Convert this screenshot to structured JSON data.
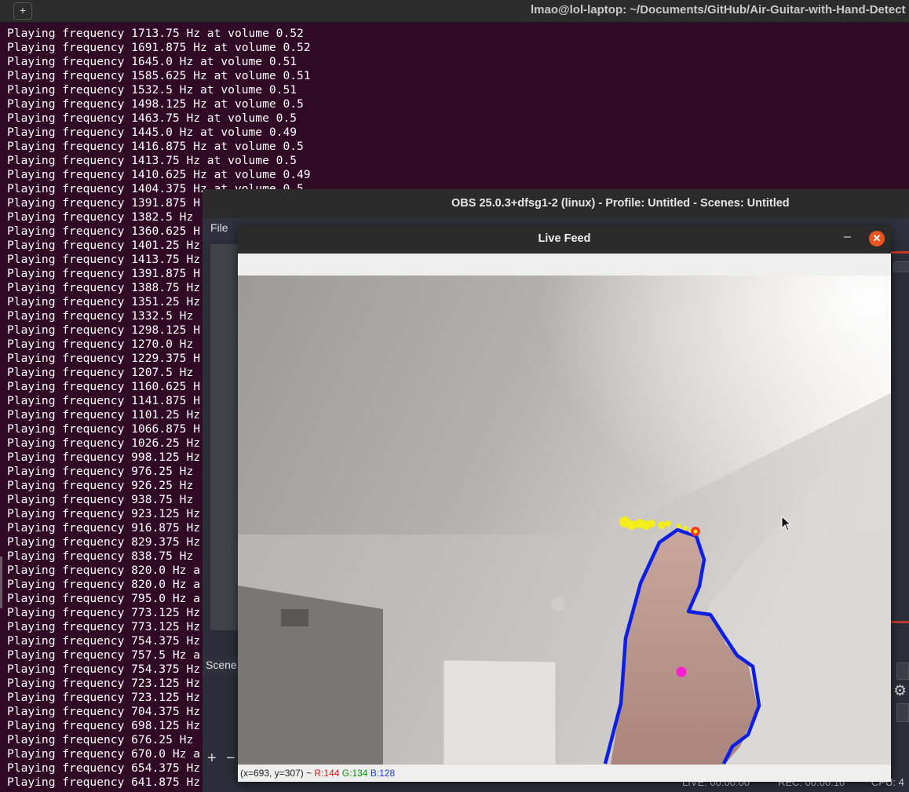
{
  "terminal": {
    "title": "lmao@lol-laptop: ~/Documents/GitHub/Air-Guitar-with-Hand-Detect",
    "new_tab_icon": "new-tab-icon",
    "lines": [
      "Playing frequency 1713.75 Hz at volume 0.52",
      "Playing frequency 1691.875 Hz at volume 0.52",
      "Playing frequency 1645.0 Hz at volume 0.51",
      "Playing frequency 1585.625 Hz at volume 0.51",
      "Playing frequency 1532.5 Hz at volume 0.51",
      "Playing frequency 1498.125 Hz at volume 0.5",
      "Playing frequency 1463.75 Hz at volume 0.5",
      "Playing frequency 1445.0 Hz at volume 0.49",
      "Playing frequency 1416.875 Hz at volume 0.5",
      "Playing frequency 1413.75 Hz at volume 0.5",
      "Playing frequency 1410.625 Hz at volume 0.49",
      "Playing frequency 1404.375 Hz at volume 0.5",
      "Playing frequency 1391.875 H",
      "Playing frequency 1382.5 Hz",
      "Playing frequency 1360.625 H",
      "Playing frequency 1401.25 Hz",
      "Playing frequency 1413.75 Hz",
      "Playing frequency 1391.875 H",
      "Playing frequency 1388.75 Hz",
      "Playing frequency 1351.25 Hz",
      "Playing frequency 1332.5 Hz",
      "Playing frequency 1298.125 H",
      "Playing frequency 1270.0 Hz",
      "Playing frequency 1229.375 H",
      "Playing frequency 1207.5 Hz",
      "Playing frequency 1160.625 H",
      "Playing frequency 1141.875 H",
      "Playing frequency 1101.25 Hz",
      "Playing frequency 1066.875 H",
      "Playing frequency 1026.25 Hz",
      "Playing frequency 998.125 Hz",
      "Playing frequency 976.25 Hz",
      "Playing frequency 926.25 Hz",
      "Playing frequency 938.75 Hz",
      "Playing frequency 923.125 Hz",
      "Playing frequency 916.875 Hz",
      "Playing frequency 829.375 Hz",
      "Playing frequency 838.75 Hz",
      "Playing frequency 820.0 Hz a",
      "Playing frequency 820.0 Hz a",
      "Playing frequency 795.0 Hz a",
      "Playing frequency 773.125 Hz",
      "Playing frequency 773.125 Hz",
      "Playing frequency 754.375 Hz",
      "Playing frequency 757.5 Hz a",
      "Playing frequency 754.375 Hz",
      "Playing frequency 723.125 Hz",
      "Playing frequency 723.125 Hz",
      "Playing frequency 704.375 Hz",
      "Playing frequency 698.125 Hz",
      "Playing frequency 676.25 Hz",
      "Playing frequency 670.0 Hz a",
      "Playing frequency 654.375 Hz",
      "Playing frequency 641.875 Hz"
    ]
  },
  "obs": {
    "title": "OBS 25.0.3+dfsg1-2 (linux) - Profile: Untitled - Scenes: Untitled",
    "menu_file": "File",
    "scenes_label": "Scene",
    "add_label": "+",
    "remove_label": "−",
    "status_live": "LIVE: 00:00:00",
    "status_rec": "REC: 00:00:10",
    "status_cpu": "CPU: 4",
    "gear_icon": "gear-icon"
  },
  "live_feed": {
    "title": "Live Feed",
    "minimize_label": "–",
    "close_label": "✕",
    "status": {
      "coords": "(x=693, y=307) ~ ",
      "r": "R:144",
      "g": "G:134",
      "b": "B:128"
    }
  },
  "colors": {
    "terminal_bg": "#300a24",
    "close_button": "#e95420",
    "contour": "#0b1fe6",
    "trail": "#f5ee1a",
    "centroid": "#ff1fd2"
  }
}
